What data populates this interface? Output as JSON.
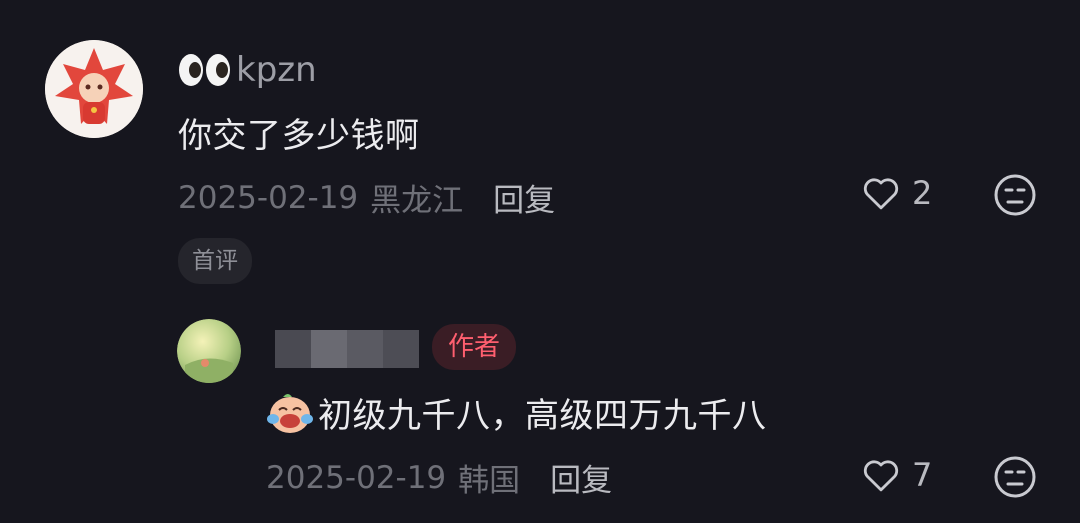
{
  "comment": {
    "username": "kpzn",
    "text": "你交了多少钱啊",
    "date": "2025-02-19",
    "location": "黑龙江",
    "reply_label": "回复",
    "like_count": "2",
    "badge": "首评"
  },
  "reply": {
    "author_badge": "作者",
    "text": "初级九千八，高级四万九千八",
    "date": "2025-02-19",
    "location": "韩国",
    "reply_label": "回复",
    "like_count": "7"
  },
  "colors": {
    "background": "#16161e",
    "author_badge_text": "#ff5f6f",
    "author_badge_bg": "#3a1d25"
  }
}
